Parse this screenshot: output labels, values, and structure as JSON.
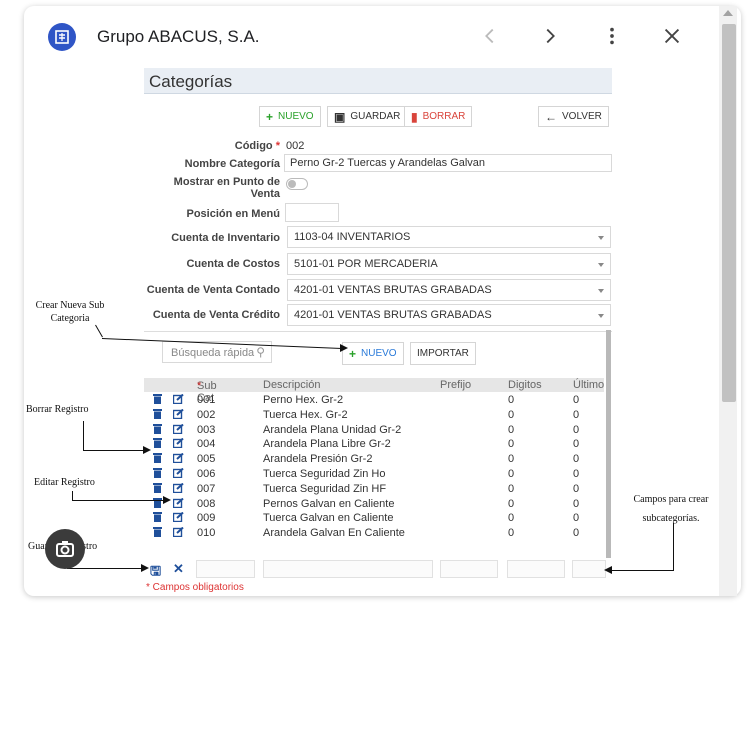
{
  "popup": {
    "title": "Grupo ABACUS, S.A.",
    "icons": [
      "app-logo-icon",
      "chevron-left-icon",
      "chevron-right-icon",
      "more-vert-icon",
      "close-icon"
    ]
  },
  "screen": {
    "title": "Categorías",
    "toolbar": {
      "new": "NUEVO",
      "save": "GUARDAR",
      "delete": "BORRAR",
      "back": "VOLVER"
    },
    "form": {
      "code_label": "Código",
      "code_required": "*",
      "code_value": "002",
      "name_label": "Nombre Categoría",
      "name_value": "Perno Gr-2 Tuercas y Arandelas Galvan",
      "pos_label": "Mostrar en Punto de Venta",
      "menu_label": "Posición en Menú",
      "inventory_label": "Cuenta de Inventario",
      "inventory_value": "1103-04 INVENTARIOS",
      "cost_label": "Cuenta de Costos",
      "cost_value": "5101-01 POR MERCADERIA",
      "cash_label": "Cuenta de Venta Contado",
      "cash_value": "4201-01 VENTAS BRUTAS GRABADAS",
      "credit_label": "Cuenta de Venta Crédito",
      "credit_value": "4201-01 VENTAS BRUTAS GRABADAS"
    },
    "subgrid": {
      "search_placeholder": "Búsqueda rápida",
      "new_button": "NUEVO",
      "import_button": "IMPORTAR",
      "headers": {
        "subcat": "Sub Cat",
        "required": "*",
        "desc": "Descripción",
        "prefix": "Prefijo",
        "digits": "Digitos",
        "last": "Último"
      },
      "rows": [
        {
          "code": "001",
          "desc": "Perno Hex. Gr-2",
          "digits": "0",
          "last": "0"
        },
        {
          "code": "002",
          "desc": "Tuerca Hex. Gr-2",
          "digits": "0",
          "last": "0"
        },
        {
          "code": "003",
          "desc": "Arandela Plana Unidad Gr-2",
          "digits": "0",
          "last": "0"
        },
        {
          "code": "004",
          "desc": "Arandela Plana Libre Gr-2",
          "digits": "0",
          "last": "0"
        },
        {
          "code": "005",
          "desc": "Arandela Presión Gr-2",
          "digits": "0",
          "last": "0"
        },
        {
          "code": "006",
          "desc": "Tuerca Seguridad Zin Ho",
          "digits": "0",
          "last": "0"
        },
        {
          "code": "007",
          "desc": "Tuerca Seguridad Zin HF",
          "digits": "0",
          "last": "0"
        },
        {
          "code": "008",
          "desc": "Pernos Galvan en Caliente",
          "digits": "0",
          "last": "0"
        },
        {
          "code": "009",
          "desc": "Tuerca Galvan en Caliente",
          "digits": "0",
          "last": "0"
        },
        {
          "code": "010",
          "desc": "Arandela Galvan En Caliente",
          "digits": "0",
          "last": "0"
        }
      ],
      "required_note": "* Campos obligatorios"
    }
  },
  "annotations": {
    "new_sub": "Crear Nueva Sub Categoria",
    "delete": "Borrar Registro",
    "edit": "Editar Registro",
    "save": "Guardar Registro",
    "fields": "Campos para crear subcategorías."
  }
}
